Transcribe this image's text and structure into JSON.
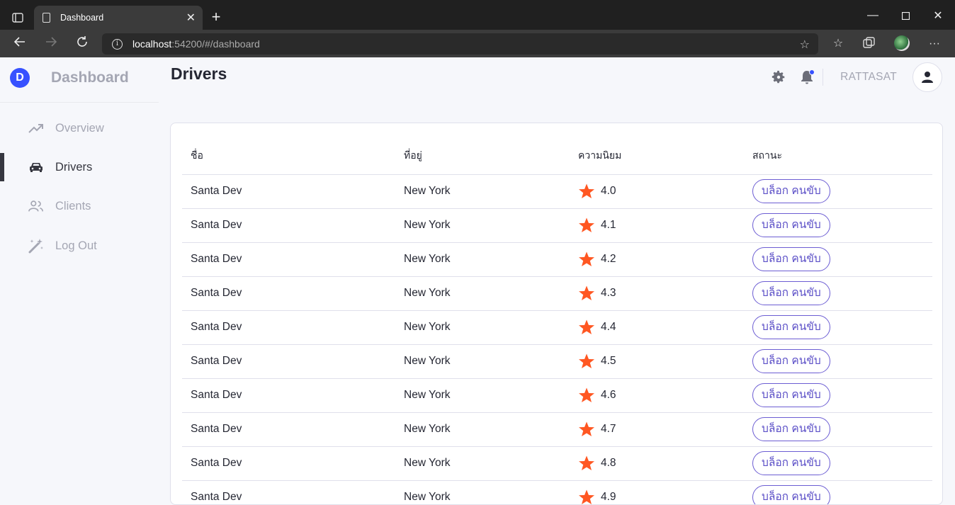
{
  "browser": {
    "tab_title": "Dashboard",
    "url_host": "localhost",
    "url_path": ":54200/#/dashboard"
  },
  "sidebar": {
    "brand_letter": "D",
    "brand_name": "Dashboard",
    "items": [
      {
        "label": "Overview",
        "icon": "trending-up-icon"
      },
      {
        "label": "Drivers",
        "icon": "car-icon",
        "active": true
      },
      {
        "label": "Clients",
        "icon": "users-icon"
      },
      {
        "label": "Log Out",
        "icon": "magic-wand-icon"
      }
    ]
  },
  "header": {
    "page_title": "Drivers",
    "username": "RATTASAT",
    "accent_color": "#3751ff"
  },
  "table": {
    "columns": [
      "ชื่อ",
      "ที่อยู่",
      "ความนิยม",
      "สถานะ"
    ],
    "star_color": "#ff5722",
    "rows": [
      {
        "name": "Santa Dev",
        "address": "New York",
        "rating": "4.0",
        "action": "บล็อก คนขับ"
      },
      {
        "name": "Santa Dev",
        "address": "New York",
        "rating": "4.1",
        "action": "บล็อก คนขับ"
      },
      {
        "name": "Santa Dev",
        "address": "New York",
        "rating": "4.2",
        "action": "บล็อก คนขับ"
      },
      {
        "name": "Santa Dev",
        "address": "New York",
        "rating": "4.3",
        "action": "บล็อก คนขับ"
      },
      {
        "name": "Santa Dev",
        "address": "New York",
        "rating": "4.4",
        "action": "บล็อก คนขับ"
      },
      {
        "name": "Santa Dev",
        "address": "New York",
        "rating": "4.5",
        "action": "บล็อก คนขับ"
      },
      {
        "name": "Santa Dev",
        "address": "New York",
        "rating": "4.6",
        "action": "บล็อก คนขับ"
      },
      {
        "name": "Santa Dev",
        "address": "New York",
        "rating": "4.7",
        "action": "บล็อก คนขับ"
      },
      {
        "name": "Santa Dev",
        "address": "New York",
        "rating": "4.8",
        "action": "บล็อก คนขับ"
      },
      {
        "name": "Santa Dev",
        "address": "New York",
        "rating": "4.9",
        "action": "บล็อก คนขับ"
      }
    ]
  }
}
